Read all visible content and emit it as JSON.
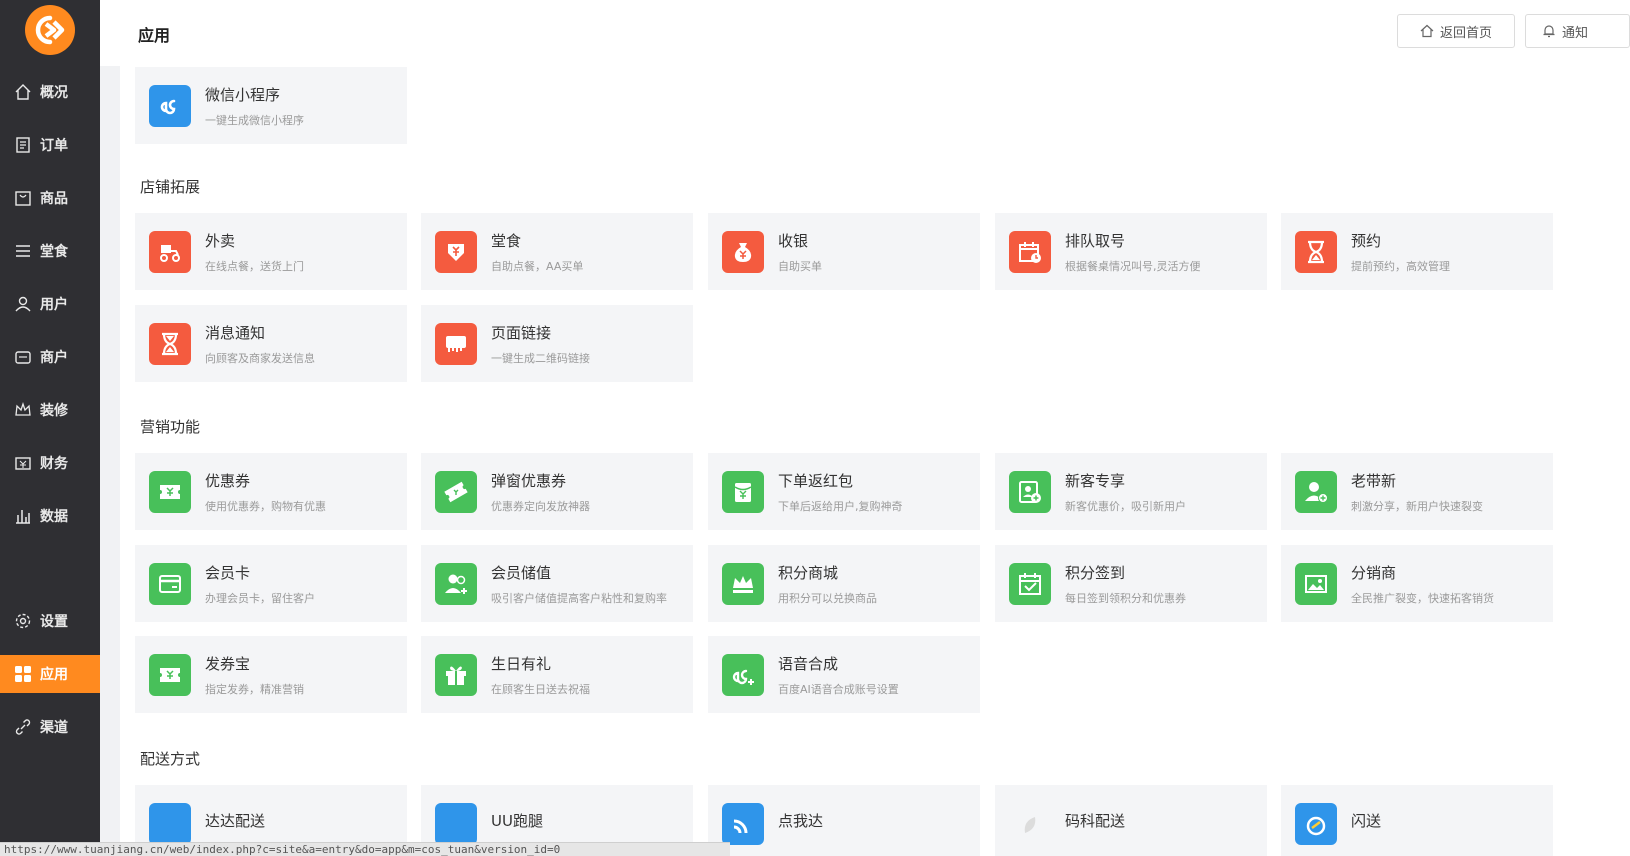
{
  "header": {
    "title": "应用",
    "home_button": "返回首页",
    "notify_button": "通知"
  },
  "sidebar": {
    "items": [
      {
        "label": "概况",
        "icon": "home-icon"
      },
      {
        "label": "订单",
        "icon": "order-icon"
      },
      {
        "label": "商品",
        "icon": "goods-icon"
      },
      {
        "label": "堂食",
        "icon": "menu-icon"
      },
      {
        "label": "用户",
        "icon": "user-icon"
      },
      {
        "label": "商户",
        "icon": "shop-icon"
      },
      {
        "label": "装修",
        "icon": "crown-icon"
      },
      {
        "label": "财务",
        "icon": "wallet-icon"
      },
      {
        "label": "数据",
        "icon": "chart-icon"
      },
      {
        "label": "设置",
        "icon": "gear-icon"
      },
      {
        "label": "应用",
        "icon": "apps-icon"
      },
      {
        "label": "渠道",
        "icon": "link-icon"
      }
    ]
  },
  "sections": {
    "top": {
      "cards": [
        {
          "title": "微信小程序",
          "desc": "一键生成微信小程序",
          "icon": "miniprogram-icon",
          "color": "#2f95ea"
        }
      ]
    },
    "store": {
      "title": "店铺拓展",
      "cards": [
        {
          "title": "外卖",
          "desc": "在线点餐，送货上门",
          "icon": "scooter-icon",
          "color": "#f45b3f"
        },
        {
          "title": "堂食",
          "desc": "自助点餐，AA买单",
          "icon": "dinein-icon",
          "color": "#f45b3f"
        },
        {
          "title": "收银",
          "desc": "自助买单",
          "icon": "moneybag-icon",
          "color": "#f45b3f"
        },
        {
          "title": "排队取号",
          "desc": "根据餐桌情况叫号,灵活方便",
          "icon": "queue-icon",
          "color": "#f45b3f"
        },
        {
          "title": "预约",
          "desc": "提前预约，高效管理",
          "icon": "hourglass-icon",
          "color": "#f45b3f"
        },
        {
          "title": "消息通知",
          "desc": "向顾客及商家发送信息",
          "icon": "hourglass-icon",
          "color": "#f45b3f"
        },
        {
          "title": "页面链接",
          "desc": "一键生成二维码链接",
          "icon": "store-icon",
          "color": "#f45b3f"
        }
      ]
    },
    "marketing": {
      "title": "营销功能",
      "cards": [
        {
          "title": "优惠券",
          "desc": "使用优惠券，购物有优惠",
          "icon": "coupon-icon",
          "color": "#48c05a"
        },
        {
          "title": "弹窗优惠券",
          "desc": "优惠券定向发放神器",
          "icon": "popup-coupon-icon",
          "color": "#48c05a"
        },
        {
          "title": "下单返红包",
          "desc": "下单后返给用户,复购神奇",
          "icon": "redpacket-icon",
          "color": "#48c05a"
        },
        {
          "title": "新客专享",
          "desc": "新客优惠价，吸引新用户",
          "icon": "newuser-icon",
          "color": "#48c05a"
        },
        {
          "title": "老带新",
          "desc": "刺激分享，新用户快速裂变",
          "icon": "referral-icon",
          "color": "#48c05a"
        },
        {
          "title": "会员卡",
          "desc": "办理会员卡，留住客户",
          "icon": "card-icon",
          "color": "#48c05a"
        },
        {
          "title": "会员储值",
          "desc": "吸引客户储值提高客户粘性和复购率",
          "icon": "member-add-icon",
          "color": "#48c05a"
        },
        {
          "title": "积分商城",
          "desc": "用积分可以兑换商品",
          "icon": "crown-icon",
          "color": "#48c05a"
        },
        {
          "title": "积分签到",
          "desc": "每日签到领积分和优惠券",
          "icon": "calendar-check-icon",
          "color": "#48c05a"
        },
        {
          "title": "分销商",
          "desc": "全民推广裂变，快速拓客销货",
          "icon": "image-icon",
          "color": "#48c05a"
        },
        {
          "title": "发券宝",
          "desc": "指定发券，精准营销",
          "icon": "coupon-icon",
          "color": "#48c05a"
        },
        {
          "title": "生日有礼",
          "desc": "在顾客生日送去祝福",
          "icon": "gift-icon",
          "color": "#48c05a"
        },
        {
          "title": "语音合成",
          "desc": "百度AI语音合成账号设置",
          "icon": "voice-icon",
          "color": "#48c05a"
        }
      ]
    },
    "delivery": {
      "title": "配送方式",
      "cards": [
        {
          "title": "达达配送",
          "desc": "",
          "icon": "delivery-icon",
          "color": "#2f95ea"
        },
        {
          "title": "UU跑腿",
          "desc": "",
          "icon": "delivery-icon",
          "color": "#2f95ea"
        },
        {
          "title": "点我达",
          "desc": "",
          "icon": "rss-icon",
          "color": "#2f95ea"
        },
        {
          "title": "码科配送",
          "desc": "",
          "icon": "leaf-icon",
          "color": "#e6e6e6"
        },
        {
          "title": "闪送",
          "desc": "",
          "icon": "flash-icon",
          "color": "#2f95ea"
        }
      ]
    }
  },
  "status_bar": {
    "url": "https://www.tuanjiang.cn/web/index.php?c=site&a=entry&do=app&m=cos_tuan&version_id=0"
  }
}
